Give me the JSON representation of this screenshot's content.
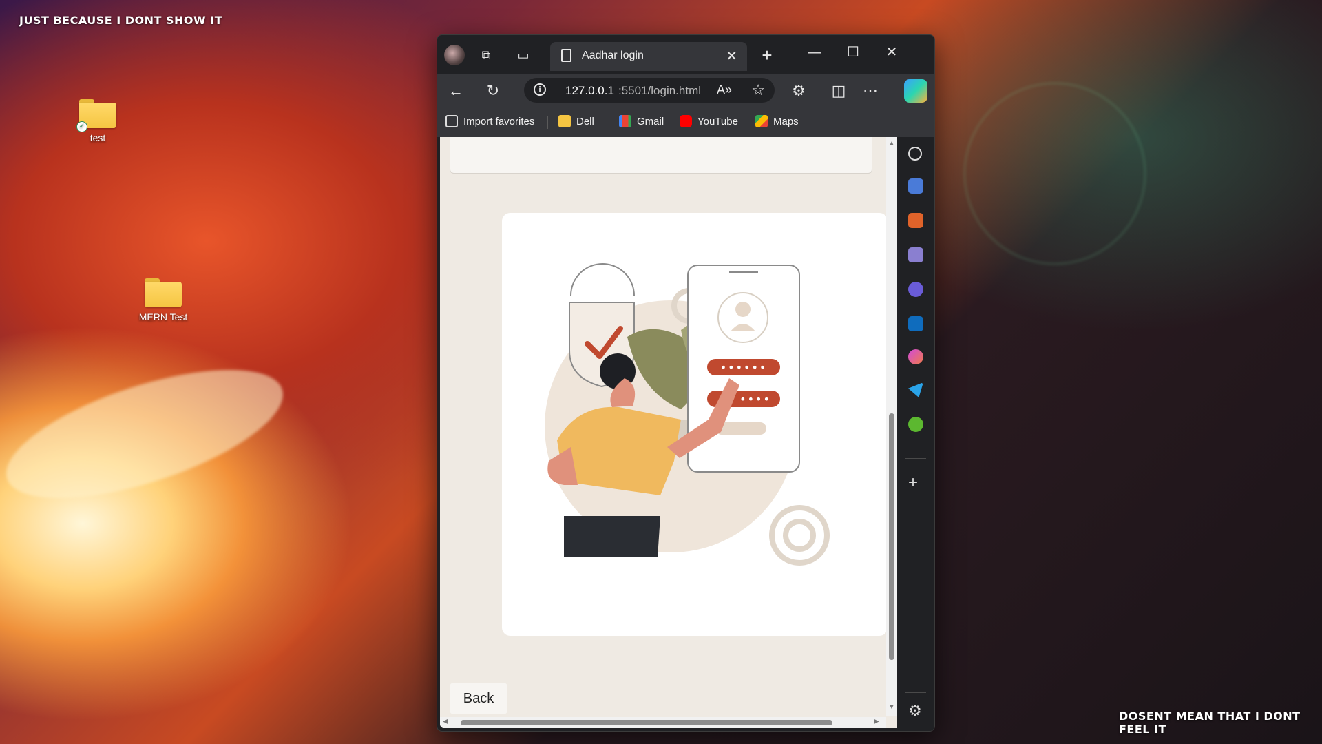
{
  "desktop": {
    "top_text": "JUST BECAUSE I DONT SHOW IT",
    "bottom_text": "DOSENT MEAN THAT I DONT FEEL IT",
    "icons": [
      {
        "label": "test",
        "icon": "folder-icon"
      },
      {
        "label": "MERN Test",
        "icon": "folder-icon"
      }
    ]
  },
  "browser": {
    "tab": {
      "title": "Aadhar login",
      "icon": "page-icon"
    },
    "address": {
      "host": "127.0.0.1",
      "rest": ":5501/login.html"
    },
    "bookmarks": [
      {
        "label": "Import favorites",
        "icon": "import-icon"
      },
      {
        "label": "Dell",
        "icon": "folder-icon"
      },
      {
        "label": "Gmail",
        "icon": "gmail-icon"
      },
      {
        "label": "YouTube",
        "icon": "youtube-icon"
      },
      {
        "label": "Maps",
        "icon": "maps-icon"
      }
    ],
    "sidebar_icons": [
      "search-icon",
      "shopping-tag-icon",
      "tools-icon",
      "games-icon",
      "copilot-icon",
      "outlook-icon",
      "designer-icon",
      "telegram-icon",
      "tree-icon",
      "add-icon",
      "settings-icon"
    ]
  },
  "page": {
    "back_label": "Back",
    "illustration": {
      "password_dots_1": "••••••",
      "password_dots_2": "••••"
    }
  },
  "colors": {
    "accent_red": "#c0492f",
    "illustration_yellow": "#f0b95e",
    "illustration_leaf": "#8a8b5c"
  }
}
